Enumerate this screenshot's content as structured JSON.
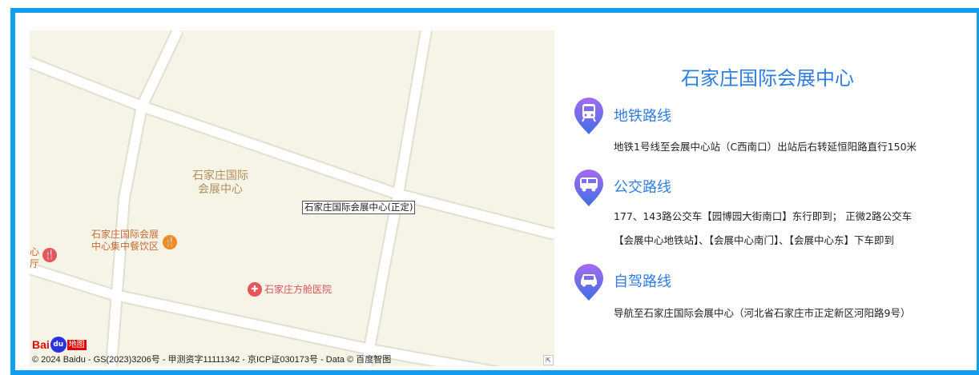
{
  "map": {
    "area_label_line1": "石家庄国际",
    "area_label_line2": "会展中心",
    "poi_restaurant_line1": "石家庄国际会展",
    "poi_restaurant_line2": "中心集中餐饮区",
    "poi_hospital": "石家庄方舱医院",
    "poi_edge_line1": "心",
    "poi_edge_line2": "厅",
    "marker_label": "石家庄国际会展中心(正定)",
    "logo_text_bai": "Bai",
    "logo_text_du": "du",
    "logo_text_ditu": "地图",
    "copyright": "© 2024 Baidu - GS(2023)3206号 - 甲测资字11111342 - 京ICP证030173号 - Data © 百度智图",
    "colors": {
      "land": "#f6f4e6",
      "road": "#ffffff",
      "road_edge": "#e2dfd0",
      "restaurant_pin": "#f28a1f",
      "hospital_pin": "#e8545b"
    }
  },
  "info": {
    "title": "石家庄国际会展中心",
    "routes": [
      {
        "icon": "subway-icon",
        "title": "地铁路线",
        "lines": [
          "地铁1号线至会展中心站（C西南口）出站后右转延恒阳路直行150米"
        ]
      },
      {
        "icon": "bus-icon",
        "title": "公交路线",
        "lines": [
          "177、143路公交车【园博园大街南口】东行即到；  正微2路公交车",
          "【会展中心地铁站】、【会展中心南门】、【会展中心东】下车即到"
        ]
      },
      {
        "icon": "car-icon",
        "title": "自驾路线",
        "lines": [
          "导航至石家庄国际会展中心（河北省石家庄市正定新区河阳路9号）"
        ]
      }
    ],
    "accent_color": "#2f7de1"
  }
}
